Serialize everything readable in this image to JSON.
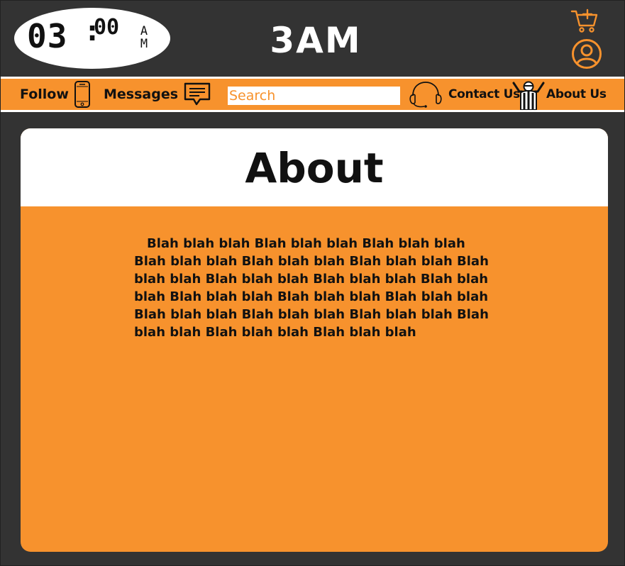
{
  "header": {
    "clock": {
      "hours": "03",
      "separator": ":",
      "minutes": "00",
      "ampm": "AM"
    },
    "brand": "3AM",
    "icons": {
      "cart": "cart-add-icon",
      "account": "user-account-icon"
    }
  },
  "nav": {
    "follow": {
      "label": "Follow",
      "icon": "phone-icon"
    },
    "messages": {
      "label": "Messages",
      "icon": "message-icon"
    },
    "search": {
      "placeholder": "Search",
      "value": ""
    },
    "contact": {
      "label": "Contact Us",
      "icon": "headset-icon"
    },
    "about": {
      "label": "About Us",
      "icon": "people-cheering-icon"
    }
  },
  "page": {
    "title": "About",
    "body": "Blah blah blah Blah blah blah Blah blah blah Blah blah blah Blah blah blah Blah blah blah Blah blah blah Blah blah blah Blah blah blah Blah blah blah Blah blah blah Blah blah blah Blah blah blah Blah blah blah Blah blah blah Blah blah blah Blah blah blah Blah blah blah Blah blah blah"
  },
  "colors": {
    "accent": "#F7922D",
    "background": "#333333",
    "surface": "#ffffff",
    "text": "#111111"
  }
}
